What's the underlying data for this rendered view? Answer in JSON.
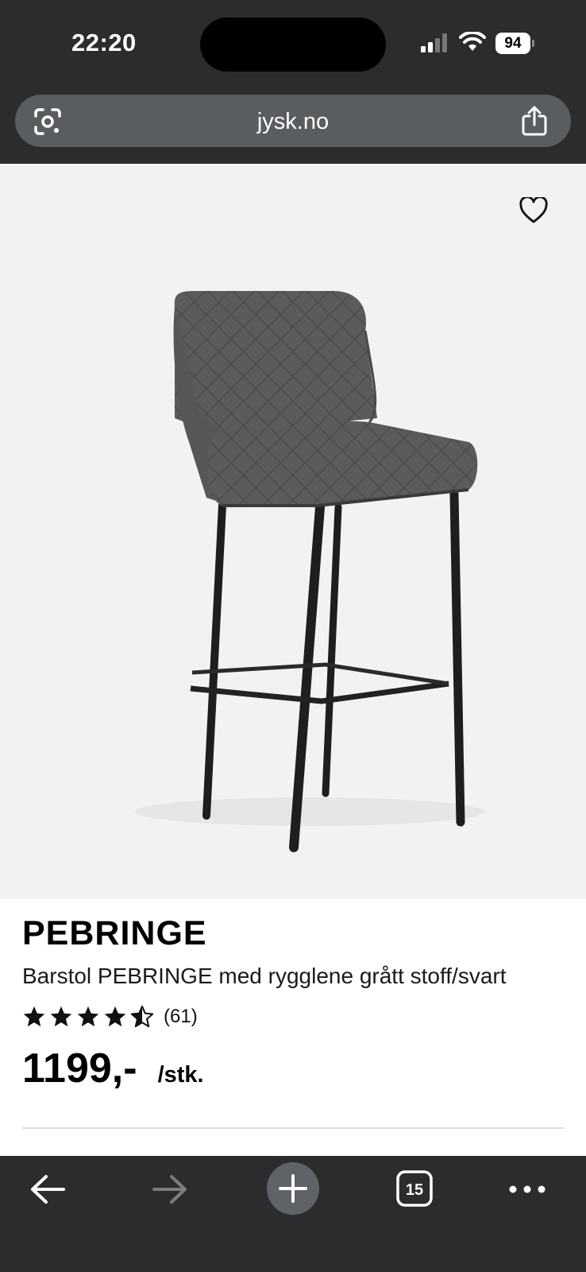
{
  "status_bar": {
    "time": "22:20",
    "battery": "94"
  },
  "browser": {
    "url": "jysk.no",
    "tab_count": "15"
  },
  "product": {
    "brand": "PEBRINGE",
    "description": "Barstol PEBRINGE med rygglene grått stoff/svart",
    "rating": 4.5,
    "review_count": "(61)",
    "price": "1199,-",
    "unit": "/stk."
  },
  "icons": {
    "lens": "google-lens-icon",
    "share": "share-icon",
    "favorite": "heart-icon",
    "back": "back-arrow-icon",
    "forward": "forward-arrow-icon",
    "new_tab": "plus-icon",
    "tabs": "tabs-icon",
    "more": "more-icon"
  }
}
